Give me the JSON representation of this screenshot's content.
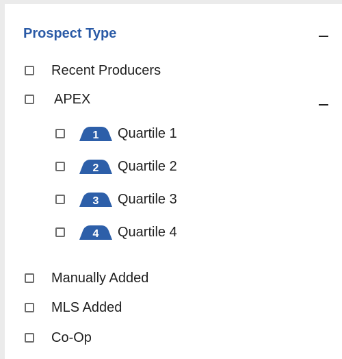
{
  "title": "Prospect Type",
  "items": {
    "recent_producers": "Recent Producers",
    "apex": "APEX",
    "quartiles": [
      {
        "number": "1",
        "label": "Quartile 1"
      },
      {
        "number": "2",
        "label": "Quartile 2"
      },
      {
        "number": "3",
        "label": "Quartile 3"
      },
      {
        "number": "4",
        "label": "Quartile 4"
      }
    ],
    "manually_added": "Manually Added",
    "mls_added": "MLS Added",
    "co_op": "Co-Op"
  },
  "colors": {
    "title": "#2a5aa6",
    "badge": "#2d5fa9"
  },
  "icons": {
    "collapse": "minus-icon",
    "badge": "quartile-badge-icon"
  }
}
